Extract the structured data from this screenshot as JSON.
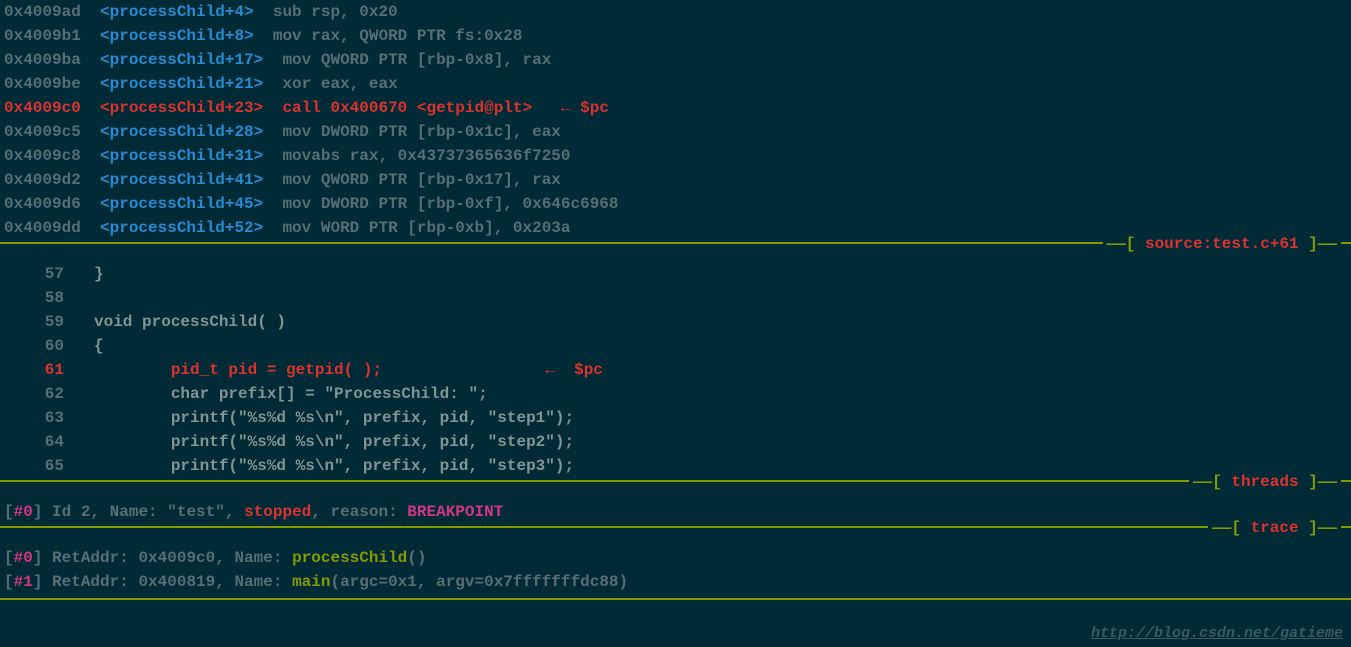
{
  "disasm": [
    {
      "addr": "0x4009ad",
      "sym": "<processChild+4>",
      "instr": "sub rsp, 0x20",
      "hl": false
    },
    {
      "addr": "0x4009b1",
      "sym": "<processChild+8>",
      "instr": "mov rax, QWORD PTR fs:0x28",
      "hl": false
    },
    {
      "addr": "0x4009ba",
      "sym": "<processChild+17>",
      "instr": "mov QWORD PTR [rbp-0x8], rax",
      "hl": false
    },
    {
      "addr": "0x4009be",
      "sym": "<processChild+21>",
      "instr": "xor eax, eax",
      "hl": false
    },
    {
      "addr": "0x4009c0",
      "sym": "<processChild+23>",
      "instr": "call 0x400670 <getpid@plt>",
      "hl": true,
      "pc": "← $pc"
    },
    {
      "addr": "0x4009c5",
      "sym": "<processChild+28>",
      "instr": "mov DWORD PTR [rbp-0x1c], eax",
      "hl": false
    },
    {
      "addr": "0x4009c8",
      "sym": "<processChild+31>",
      "instr": "movabs rax, 0x43737365636f7250",
      "hl": false
    },
    {
      "addr": "0x4009d2",
      "sym": "<processChild+41>",
      "instr": "mov QWORD PTR [rbp-0x17], rax",
      "hl": false
    },
    {
      "addr": "0x4009d6",
      "sym": "<processChild+45>",
      "instr": "mov DWORD PTR [rbp-0xf], 0x646c6968",
      "hl": false
    },
    {
      "addr": "0x4009dd",
      "sym": "<processChild+52>",
      "instr": "mov WORD PTR [rbp-0xb], 0x203a",
      "hl": false
    }
  ],
  "source_section": {
    "label": "source:test.c+61"
  },
  "source": [
    {
      "no": "57",
      "code": "}",
      "hl": false
    },
    {
      "no": "58",
      "code": "",
      "hl": false
    },
    {
      "no": "59",
      "code": "void processChild( )",
      "hl": false
    },
    {
      "no": "60",
      "code": "{",
      "hl": false
    },
    {
      "no": "61",
      "code": "        pid_t pid = getpid( );",
      "hl": true,
      "pc": "←  $pc"
    },
    {
      "no": "62",
      "code": "        char prefix[] = \"ProcessChild: \";",
      "hl": false
    },
    {
      "no": "63",
      "code": "        printf(\"%s%d %s\\n\", prefix, pid, \"step1\");",
      "hl": false
    },
    {
      "no": "64",
      "code": "        printf(\"%s%d %s\\n\", prefix, pid, \"step2\");",
      "hl": false
    },
    {
      "no": "65",
      "code": "        printf(\"%s%d %s\\n\", prefix, pid, \"step3\");",
      "hl": false
    }
  ],
  "threads_section": {
    "label": "threads"
  },
  "threads": [
    {
      "idx": "#0",
      "rest1": " Id 2, Name: \"test\", ",
      "stopped": "stopped",
      "rest2": ", reason: ",
      "reason": "BREAKPOINT"
    }
  ],
  "trace_section": {
    "label": "trace"
  },
  "trace": [
    {
      "idx": "#0",
      "rest": " RetAddr: 0x4009c0, Name: ",
      "func": "processChild",
      "args": "()"
    },
    {
      "idx": "#1",
      "rest": " RetAddr: 0x400819, Name: ",
      "func": "main",
      "args": "(argc=0x1, argv=0x7fffffffdc88)"
    }
  ],
  "watermark": "http://blog.csdn.net/gatieme"
}
